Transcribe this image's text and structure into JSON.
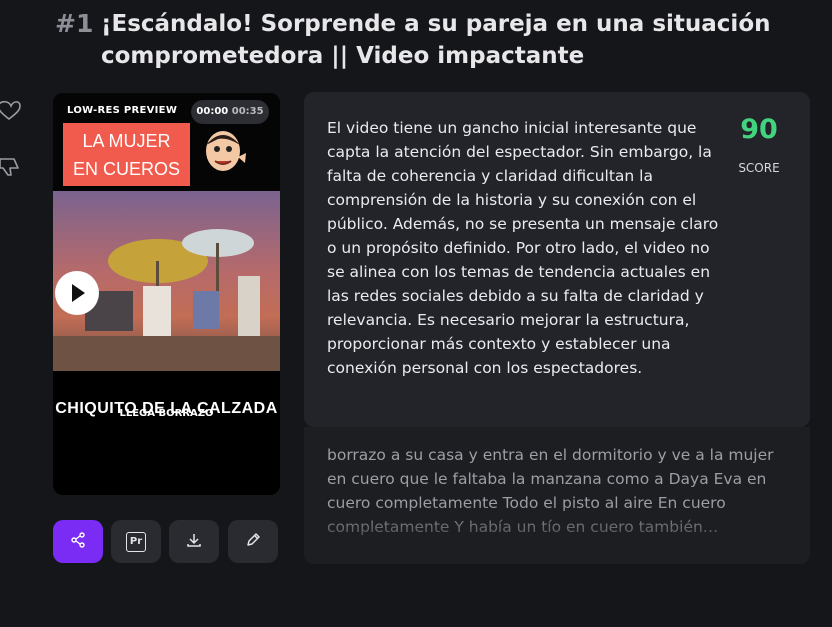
{
  "result": {
    "rank": "#1",
    "title": "¡Escándalo! Sorprende a su pareja en una situación comprometedora || Video impactante"
  },
  "video": {
    "badge": "LOW-RES PREVIEW",
    "time_current": "00:00",
    "time_total": "00:35",
    "overlay_text_line1": "LA MUJER",
    "overlay_text_line2": "EN CUEROS",
    "caption": "CHIQUITO DE LA CALZADA",
    "subtitle": "LLEGA BORRAZO"
  },
  "feedback": {
    "score": "90",
    "score_label": "SCORE",
    "description": "El video tiene un gancho inicial interesante que capta la atención del espectador. Sin embargo, la falta de coherencia y claridad dificultan la comprensión de la historia y su conexión con el público. Además, no se presenta un mensaje claro o un propósito definido. Por otro lado, el video no se alinea con los temas de tendencia actuales en las redes sociales debido a su falta de claridad y relevancia. Es necesario mejorar la estructura, proporcionar más contexto y establecer una conexión personal con los espectadores.",
    "transcript": "borrazo a su casa y entra en el dormitorio y ve a la mujer en cuero que le faltaba la manzana como a Daya Eva en cuero completamente Todo el pisto al aire En cuero completamente Y había un tío en cuero también…"
  },
  "actions": {
    "premiere_label": "Pr"
  },
  "icons": {
    "like": "heart-icon",
    "dislike": "thumbs-down-icon",
    "share": "share-icon",
    "premiere": "premiere-icon",
    "download": "download-icon",
    "edit": "pencil-icon",
    "play": "play-icon"
  },
  "colors": {
    "accent": "#7a2cf5",
    "score": "#43d37f"
  }
}
